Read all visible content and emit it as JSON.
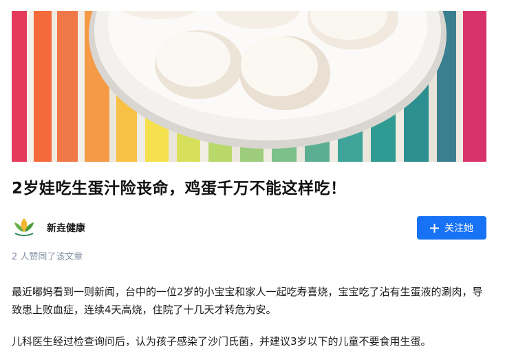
{
  "article": {
    "title": "2岁娃吃生蛋汁险丧命，鸡蛋千万不能这样吃！",
    "author_name": "新垚健康",
    "follow_label": "关注她",
    "likes_text": "2 人赞同了该文章",
    "paragraphs": [
      "最近嘟妈看到一则新闻，台中的一位2岁的小宝宝和家人一起吃寿喜烧，宝宝吃了沾有生蛋液的涮肉，导致患上败血症，连续4天高烧，住院了十几天才转危为安。",
      "儿科医生经过检查询问后，认为孩子感染了沙门氏菌，并建议3岁以下的儿童不要食用生蛋。"
    ]
  },
  "icons": {
    "avatar": "leaf-logo-icon",
    "follow": "plus-icon"
  },
  "colors": {
    "accent": "#1772f6",
    "muted_text": "#8590a6"
  }
}
